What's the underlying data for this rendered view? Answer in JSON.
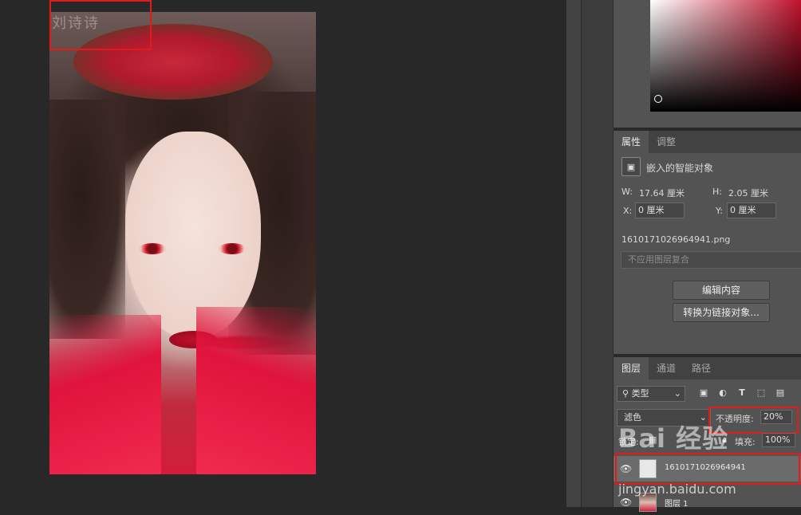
{
  "canvas": {
    "watermark_text": "刘诗诗"
  },
  "properties_panel": {
    "tabs": [
      {
        "label": "属性",
        "active": true
      },
      {
        "label": "调整",
        "active": false
      }
    ],
    "object_type_label": "嵌入的智能对象",
    "w_label": "W:",
    "w_value": "17.64 厘米",
    "h_label": "H:",
    "h_value": "2.05 厘米",
    "x_label": "X:",
    "x_value": "0 厘米",
    "y_label": "Y:",
    "y_value": "0 厘米",
    "filename": "1610171026964941.png",
    "layer_comp_select": "不应用图层复合",
    "edit_contents_button": "编辑内容",
    "convert_linked_button": "转换为链接对象..."
  },
  "layers_panel": {
    "tabs": [
      {
        "label": "图层",
        "active": true
      },
      {
        "label": "通道",
        "active": false
      },
      {
        "label": "路径",
        "active": false
      }
    ],
    "filter_select": "类型",
    "blend_mode": "滤色",
    "opacity_label": "不透明度:",
    "opacity_value": "20%",
    "lock_label": "锁定:",
    "fill_label": "填充:",
    "fill_value": "100%",
    "layers": [
      {
        "name": "1610171026964941",
        "selected": true,
        "visible": true
      },
      {
        "name": "图层 1",
        "selected": false,
        "visible": true
      }
    ]
  },
  "watermark": {
    "brand": "Bai 经验",
    "url": "jingyan.baidu.com"
  },
  "colors": {
    "highlight_box": "#e21a1a",
    "panel_bg": "#535353",
    "canvas_bg": "#282828"
  }
}
